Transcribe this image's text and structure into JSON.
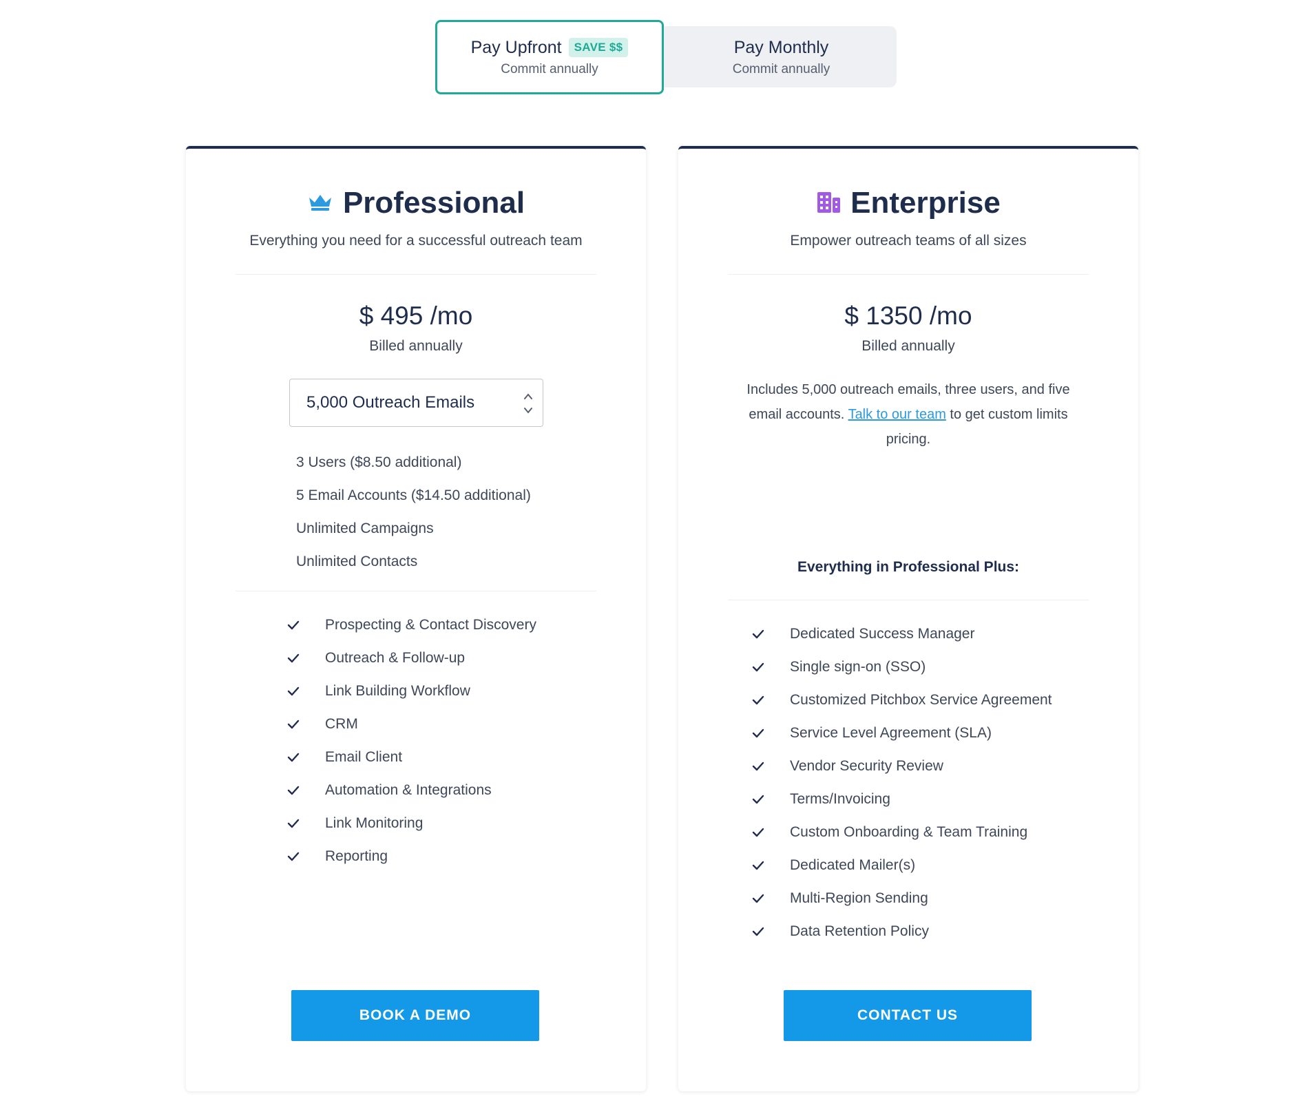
{
  "billing_toggle": {
    "upfront": {
      "title": "Pay Upfront",
      "badge": "SAVE $$",
      "subtitle": "Commit annually",
      "selected": true
    },
    "monthly": {
      "title": "Pay Monthly",
      "subtitle": "Commit annually",
      "selected": false
    }
  },
  "professional": {
    "icon": "crown-icon",
    "name": "Professional",
    "description": "Everything you need for a successful outreach team",
    "price": "$ 495 /mo",
    "billing": "Billed annually",
    "emails_select": {
      "value": "5,000 Outreach Emails"
    },
    "limits": [
      "3 Users ($8.50 additional)",
      "5 Email Accounts ($14.50 additional)",
      "Unlimited Campaigns",
      "Unlimited Contacts"
    ],
    "features": [
      "Prospecting & Contact Discovery",
      "Outreach & Follow-up",
      "Link Building Workflow",
      "CRM",
      "Email Client",
      "Automation & Integrations",
      "Link Monitoring",
      "Reporting"
    ],
    "cta": "BOOK A DEMO"
  },
  "enterprise": {
    "icon": "building-icon",
    "name": "Enterprise",
    "description": "Empower outreach teams of all sizes",
    "price": "$ 1350 /mo",
    "billing": "Billed annually",
    "info_before": "Includes 5,000 outreach emails, three users, and five email accounts. ",
    "info_link": "Talk to our team",
    "info_after": " to get custom limits pricing.",
    "plus_heading": "Everything in Professional Plus:",
    "features": [
      "Dedicated Success Manager",
      "Single sign-on (SSO)",
      "Customized Pitchbox Service Agreement",
      "Service Level Agreement (SLA)",
      "Vendor Security Review",
      "Terms/Invoicing",
      "Custom Onboarding & Team Training",
      "Dedicated Mailer(s)",
      "Multi-Region Sending",
      "Data Retention Policy"
    ],
    "cta": "CONTACT US"
  },
  "colors": {
    "accent_teal": "#1eaa97",
    "cta_blue": "#1399e8",
    "navy": "#1f2d4d",
    "crown_blue": "#2b9ae0",
    "building_purple": "#a259e6",
    "link_blue": "#2b9ae0"
  }
}
